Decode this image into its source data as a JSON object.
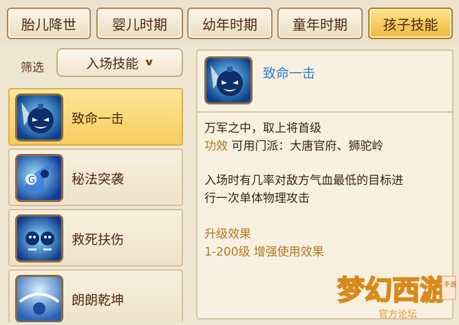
{
  "tabs": [
    {
      "label": "胎儿降世",
      "active": false
    },
    {
      "label": "婴儿时期",
      "active": false
    },
    {
      "label": "幼年时期",
      "active": false
    },
    {
      "label": "童年时期",
      "active": false
    },
    {
      "label": "孩子技能",
      "active": true
    }
  ],
  "filter": {
    "label": "筛选",
    "selected": "入场技能"
  },
  "skills": [
    {
      "label": "致命一击",
      "icon": "skull-bomb-icon",
      "selected": true
    },
    {
      "label": "秘法突袭",
      "icon": "arcane-strike-icon",
      "selected": false
    },
    {
      "label": "救死扶伤",
      "icon": "healing-spirits-icon",
      "selected": false
    },
    {
      "label": "朗朗乾坤",
      "icon": "bright-sky-icon",
      "selected": false
    }
  ],
  "detail": {
    "title": "致命一击",
    "quote": "万军之中，取上将首级",
    "effect_label": "功效",
    "effect_text": "可用门派：大唐官府、狮驼岭",
    "desc_line1": "入场时有几率对敌方气血最低的目标进",
    "desc_line2": "行一次单体物理攻击",
    "upgrade_title": "升级效果",
    "upgrade_range": "1-200级",
    "upgrade_text": "增强使用效果"
  },
  "logo": {
    "text": "梦幻西游",
    "sub": "官方论坛",
    "badge": "手游"
  },
  "colors": {
    "accent_blue": "#2d7fc8",
    "gold_text": "#b3771f",
    "tab_active": "#f6c24a"
  }
}
